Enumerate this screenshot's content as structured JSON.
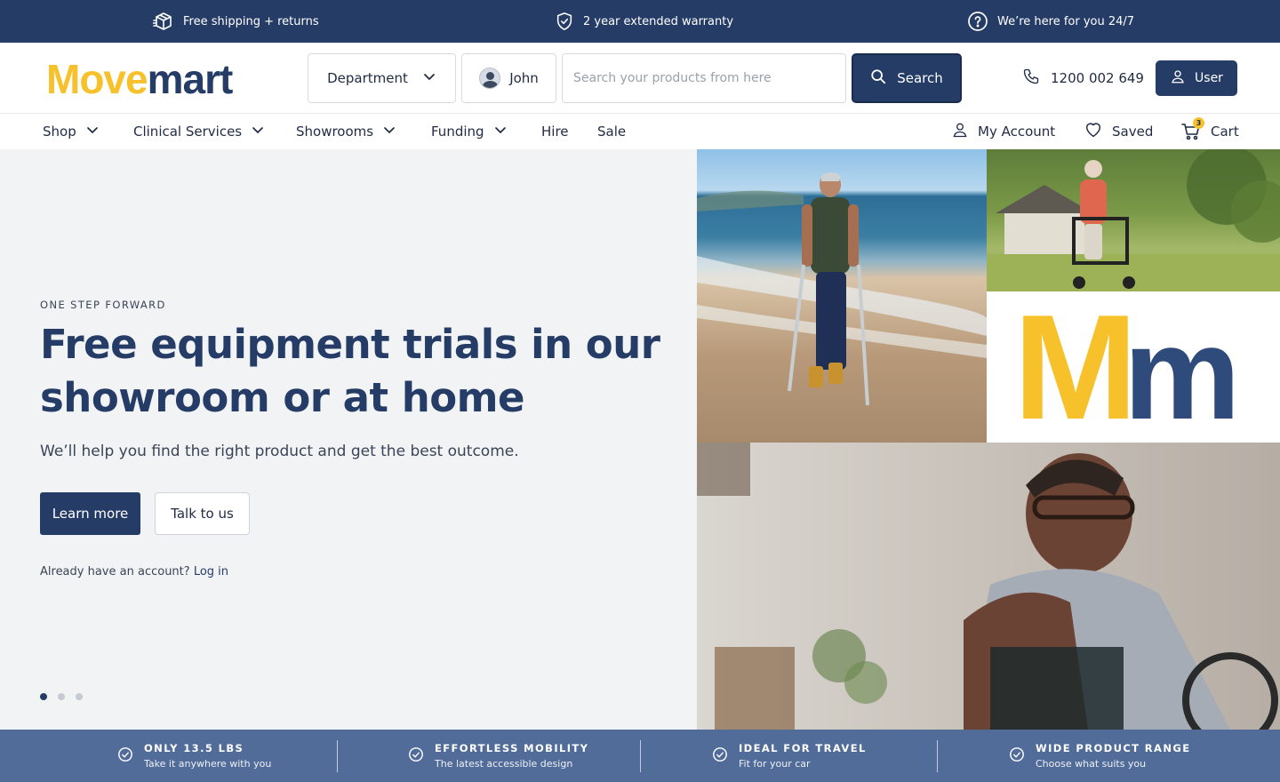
{
  "topbar": {
    "items": [
      {
        "icon": "package-icon",
        "label": "Free shipping + returns"
      },
      {
        "icon": "shield-check-icon",
        "label": "2 year extended warranty"
      },
      {
        "icon": "help-circle-icon",
        "label": "We’re here for you 24/7"
      }
    ]
  },
  "header": {
    "logo_part1": "Move",
    "logo_part2": "mart",
    "department_label": "Department",
    "user_chip_name": "John",
    "search_placeholder": "Search your products from here",
    "search_value": "",
    "search_button_label": "Search",
    "phone_number": "1200 002 649",
    "user_button_label": "User"
  },
  "nav": {
    "items": [
      {
        "label": "Shop",
        "has_dropdown": true
      },
      {
        "label": "Clinical Services",
        "has_dropdown": true
      },
      {
        "label": "Showrooms",
        "has_dropdown": true
      },
      {
        "label": "Funding",
        "has_dropdown": true
      },
      {
        "label": "Hire",
        "has_dropdown": false
      },
      {
        "label": "Sale",
        "has_dropdown": false
      }
    ],
    "account_label": "My Account",
    "saved_label": "Saved",
    "cart_label": "Cart",
    "cart_count": "3"
  },
  "hero": {
    "eyebrow": "ONE STEP FORWARD",
    "headline": "Free equipment trials in our showroom or at home",
    "subtext": "We’ll help you find the right product and get the best outcome.",
    "primary_button": "Learn more",
    "secondary_button": "Talk to us",
    "account_prompt": "Already have an account?",
    "login_link": "Log in",
    "slides_total": 3,
    "active_slide": 1
  },
  "collage": {
    "logo_letters": [
      "M",
      "m"
    ]
  },
  "features": [
    {
      "title": "ONLY 13.5 LBS",
      "subtitle": "Take it anywhere with you"
    },
    {
      "title": "EFFORTLESS MOBILITY",
      "subtitle": "The latest accessible design"
    },
    {
      "title": "IDEAL FOR TRAVEL",
      "subtitle": "Fit for your car"
    },
    {
      "title": "WIDE PRODUCT RANGE",
      "subtitle": "Choose what suits you"
    }
  ],
  "colors": {
    "brand_navy": "#253c66",
    "brand_yellow": "#f7c12b",
    "feature_bar": "#516c99",
    "hero_bg": "#f2f3f5"
  }
}
